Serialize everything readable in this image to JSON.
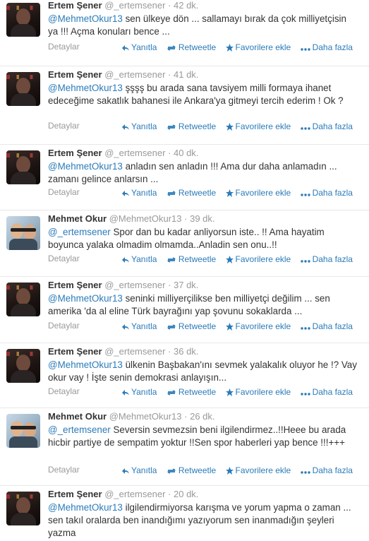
{
  "colors": {
    "link": "#2b7bb9",
    "muted": "#999999",
    "text": "#333333"
  },
  "actions": {
    "reply": "Yanıtla",
    "retweet": "Retweetle",
    "favorite": "Favorilere ekle",
    "more": "Daha fazla",
    "details": "Detaylar"
  },
  "tweets": [
    {
      "name": "Ertem Şener",
      "handle": "@_ertemsener",
      "time": "42 dk.",
      "mention": "@MehmetOkur13",
      "text": " sen ülkeye dön ... sallamayı bırak da çok milliyetçisin ya !!! Açma konuları bence ..."
    },
    {
      "name": "Ertem Şener",
      "handle": "@_ertemsener",
      "time": "41 dk.",
      "mention": "@MehmetOkur13",
      "text": " şşşş bu arada sana tavsiyem milli formaya ihanet edeceğime sakatlık bahanesi ile Ankara'ya gitmeyi tercih ederim ! Ok ?"
    },
    {
      "name": "Ertem Şener",
      "handle": "@_ertemsener",
      "time": "40 dk.",
      "mention": "@MehmetOkur13",
      "text": " anladın sen anladın !!! Ama dur daha anlamadın ... zamanı gelince anlarsın ..."
    },
    {
      "name": "Mehmet Okur",
      "handle": "@MehmetOkur13",
      "time": "39 dk.",
      "mention": "@_ertemsener",
      "text": " Spor dan bu kadar anliyorsun iste.. !! Ama hayatim boyunca yalaka olmadim olmamda..Anladin sen onu..!!"
    },
    {
      "name": "Ertem Şener",
      "handle": "@_ertemsener",
      "time": "37 dk.",
      "mention": "@MehmetOkur13",
      "text": " seninki milliyerçilikse ben milliyetçi değilim ... sen amerika 'da al eline Türk bayrağını yap şovunu sokaklarda ..."
    },
    {
      "name": "Ertem Şener",
      "handle": "@_ertemsener",
      "time": "36 dk.",
      "mention": "@MehmetOkur13",
      "text": " ülkenin Başbakan'ını sevmek yalakalık oluyor he !? Vay okur vay ! İşte senin demokrasi anlayışın..."
    },
    {
      "name": "Mehmet Okur",
      "handle": "@MehmetOkur13",
      "time": "26 dk.",
      "mention": "@_ertemsener",
      "text": " Seversin sevmezsin beni ilgilendirmez..!!Heee bu arada hicbir partiye de sempatim yoktur !!Sen spor haberleri yap bence !!!+++"
    },
    {
      "name": "Ertem Şener",
      "handle": "@_ertemsener",
      "time": "20 dk.",
      "mention": "@MehmetOkur13",
      "text": " ilgilendirmiyorsa karışma ve yorum yapma o zaman ... sen takıl oralarda ben inandığımı yazıyorum sen inanmadığın şeyleri yazma"
    }
  ]
}
